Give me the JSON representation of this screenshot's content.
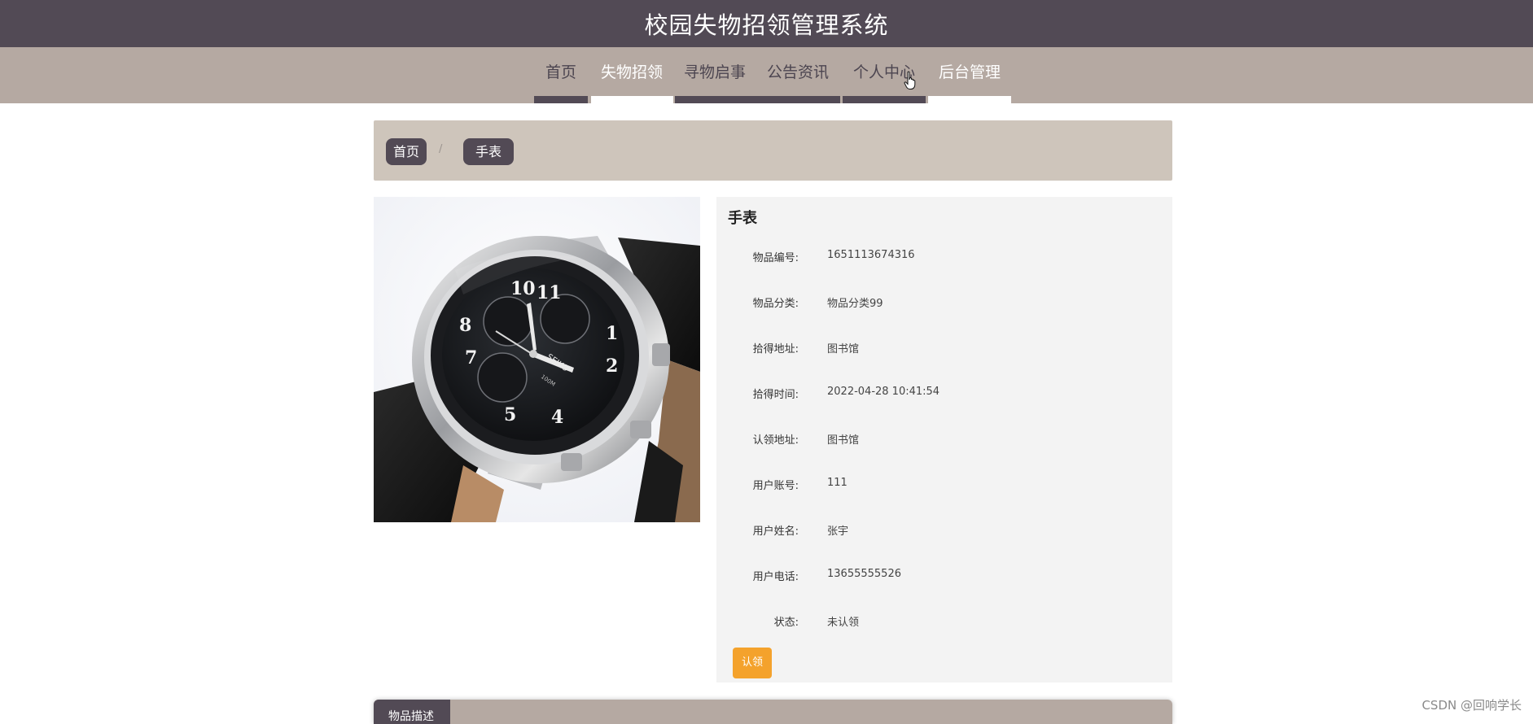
{
  "header": {
    "title": "校园失物招领管理系统"
  },
  "nav": {
    "items": [
      {
        "label": "首页"
      },
      {
        "label": "失物招领"
      },
      {
        "label": "寻物启事"
      },
      {
        "label": "公告资讯"
      },
      {
        "label": "个人中心"
      },
      {
        "label": "后台管理"
      }
    ]
  },
  "breadcrumb": {
    "home": "首页",
    "separator": "/",
    "current": "手表"
  },
  "item": {
    "name": "手表",
    "image_icon": "wristwatch-photo",
    "fields": [
      {
        "label": "物品编号:",
        "value": "1651113674316"
      },
      {
        "label": "物品分类:",
        "value": "物品分类99"
      },
      {
        "label": "拾得地址:",
        "value": "图书馆"
      },
      {
        "label": "拾得时间:",
        "value": "2022-04-28 10:41:54"
      },
      {
        "label": "认领地址:",
        "value": "图书馆"
      },
      {
        "label": "用户账号:",
        "value": "111"
      },
      {
        "label": "用户姓名:",
        "value": "张宇"
      },
      {
        "label": "用户电话:",
        "value": "13655555526"
      },
      {
        "label": "状态:",
        "value": "未认领"
      }
    ],
    "claim_label": "认领"
  },
  "tabs": {
    "description": "物品描述"
  },
  "watermark": "CSDN @回响学长",
  "colors": {
    "header_bg": "#524a55",
    "nav_bg": "#b5a9a2",
    "breadcrumb_bg": "#cec5bb",
    "claim_button": "#f4a22c",
    "panel_bg": "#f3f3f3"
  }
}
